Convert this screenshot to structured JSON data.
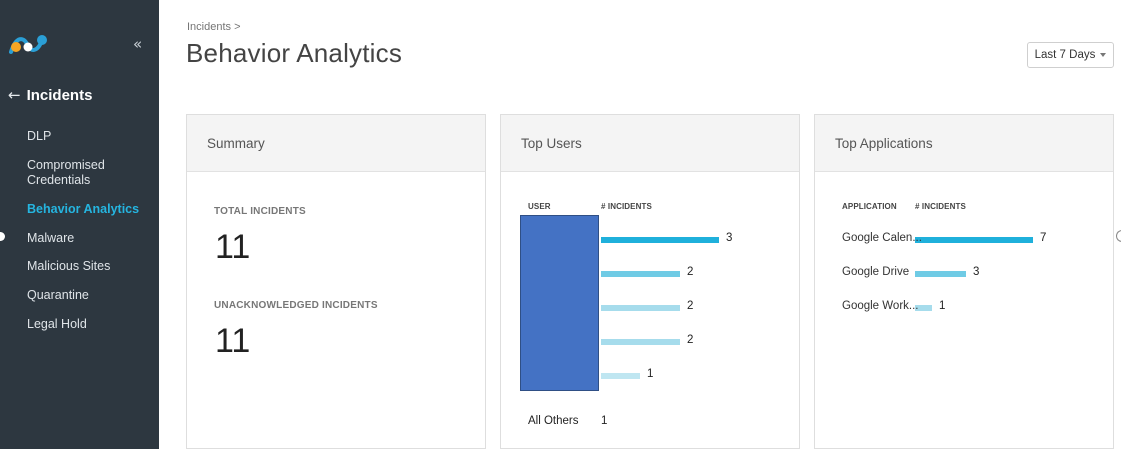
{
  "sidebar": {
    "logo_colors": [
      "#f6a623",
      "#2a9fd6"
    ],
    "collapse_icon": "«",
    "back_icon": "←",
    "section_title": "Incidents",
    "items": [
      {
        "label": "DLP",
        "active": false
      },
      {
        "label": "Compromised Credentials",
        "active": false
      },
      {
        "label": "Behavior Analytics",
        "active": true
      },
      {
        "label": "Malware",
        "active": false
      },
      {
        "label": "Malicious Sites",
        "active": false
      },
      {
        "label": "Quarantine",
        "active": false
      },
      {
        "label": "Legal Hold",
        "active": false
      }
    ]
  },
  "header": {
    "breadcrumb": "Incidents >",
    "title": "Behavior Analytics",
    "date_filter": "Last 7 Days"
  },
  "summary": {
    "title": "Summary",
    "total_label": "TOTAL INCIDENTS",
    "total_value": "11",
    "unack_label": "UNACKNOWLEDGED INCIDENTS",
    "unack_value": "11"
  },
  "top_users": {
    "title": "Top Users",
    "col_user": "USER",
    "col_incidents": "# INCIDENTS",
    "rows": [
      {
        "value": 3,
        "label": "3",
        "color": "#1fb0db"
      },
      {
        "value": 2,
        "label": "2",
        "color": "#6fcbe5"
      },
      {
        "value": 2,
        "label": "2",
        "color": "#a6dcec"
      },
      {
        "value": 2,
        "label": "2",
        "color": "#a6dcec"
      },
      {
        "value": 1,
        "label": "1",
        "color": "#bfe6f1"
      }
    ],
    "others_label": "All Others",
    "others_value": "1",
    "redaction_color": "#4472c4"
  },
  "top_apps": {
    "title": "Top Applications",
    "col_app": "APPLICATION",
    "col_incidents": "# INCIDENTS",
    "rows": [
      {
        "name": "Google Calen...",
        "value": 7,
        "label": "7",
        "color": "#1fb0db"
      },
      {
        "name": "Google Drive",
        "value": 3,
        "label": "3",
        "color": "#6fcbe5"
      },
      {
        "name": "Google Work...",
        "value": 1,
        "label": "1",
        "color": "#a6dcec"
      }
    ]
  }
}
